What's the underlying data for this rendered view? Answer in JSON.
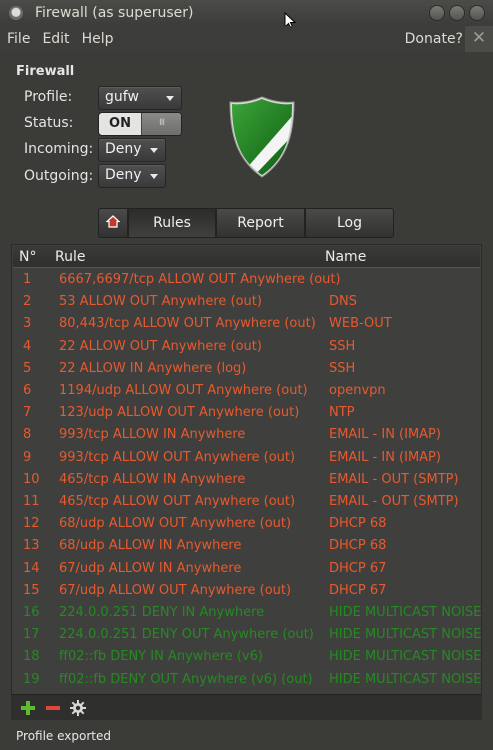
{
  "window": {
    "title": "Firewall (as superuser)",
    "buttons": [
      "•",
      "•",
      "•"
    ]
  },
  "menu": {
    "items": [
      "File",
      "Edit",
      "Help"
    ],
    "donate": "Donate?",
    "close_glyph": "✕"
  },
  "firewall": {
    "section_title": "Firewall",
    "profile_label": "Profile:",
    "profile_value": "gufw",
    "status_label": "Status:",
    "status_value": "ON",
    "status_knob": "III",
    "incoming_label": "Incoming:",
    "incoming_value": "Deny",
    "outgoing_label": "Outgoing:",
    "outgoing_value": "Deny"
  },
  "tabs": {
    "home_icon": "home-icon",
    "items": [
      "Rules",
      "Report",
      "Log"
    ],
    "active": "Rules"
  },
  "rules": {
    "columns": [
      "N°",
      "Rule",
      "Name"
    ],
    "rows": [
      {
        "n": "1",
        "rule": "6667,6697/tcp ALLOW OUT Anywhere (out)",
        "name": "",
        "color": "#e85a2e"
      },
      {
        "n": "2",
        "rule": "53 ALLOW OUT Anywhere (out)",
        "name": "DNS",
        "color": "#e85a2e"
      },
      {
        "n": "3",
        "rule": "80,443/tcp ALLOW OUT Anywhere (out)",
        "name": "WEB-OUT",
        "color": "#e85a2e"
      },
      {
        "n": "4",
        "rule": "22 ALLOW OUT Anywhere (out)",
        "name": "SSH",
        "color": "#e85a2e"
      },
      {
        "n": "5",
        "rule": "22 ALLOW IN Anywhere (log)",
        "name": "SSH",
        "color": "#e85a2e"
      },
      {
        "n": "6",
        "rule": "1194/udp ALLOW OUT Anywhere (out)",
        "name": "openvpn",
        "color": "#e85a2e"
      },
      {
        "n": "7",
        "rule": "123/udp ALLOW OUT Anywhere (out)",
        "name": "NTP",
        "color": "#e85a2e"
      },
      {
        "n": "8",
        "rule": "993/tcp ALLOW IN Anywhere",
        "name": "EMAIL - IN (IMAP)",
        "color": "#e85a2e"
      },
      {
        "n": "9",
        "rule": "993/tcp ALLOW OUT Anywhere (out)",
        "name": "EMAIL - IN (IMAP)",
        "color": "#e85a2e"
      },
      {
        "n": "10",
        "rule": "465/tcp ALLOW IN Anywhere",
        "name": "EMAIL - OUT (SMTP)",
        "color": "#e85a2e"
      },
      {
        "n": "11",
        "rule": "465/tcp ALLOW OUT Anywhere (out)",
        "name": "EMAIL - OUT (SMTP)",
        "color": "#e85a2e"
      },
      {
        "n": "12",
        "rule": "68/udp ALLOW OUT Anywhere (out)",
        "name": "DHCP 68",
        "color": "#e85a2e"
      },
      {
        "n": "13",
        "rule": "68/udp ALLOW IN Anywhere",
        "name": "DHCP 68",
        "color": "#e85a2e"
      },
      {
        "n": "14",
        "rule": "67/udp ALLOW IN Anywhere",
        "name": "DHCP 67",
        "color": "#e85a2e"
      },
      {
        "n": "15",
        "rule": "67/udp ALLOW OUT Anywhere (out)",
        "name": "DHCP 67",
        "color": "#e85a2e"
      },
      {
        "n": "16",
        "rule": "224.0.0.251 DENY IN Anywhere",
        "name": "HIDE MULTICAST NOISE",
        "color": "#268a23"
      },
      {
        "n": "17",
        "rule": "224.0.0.251 DENY OUT Anywhere (out)",
        "name": "HIDE MULTICAST NOISE",
        "color": "#268a23"
      },
      {
        "n": "18",
        "rule": "ff02::fb DENY IN Anywhere (v6)",
        "name": "HIDE MULTICAST NOISE",
        "color": "#268a23"
      },
      {
        "n": "19",
        "rule": "ff02::fb DENY OUT Anywhere (v6) (out)",
        "name": "HIDE MULTICAST NOISE",
        "color": "#268a23"
      }
    ]
  },
  "toolbar": {
    "add_icon": "plus-icon",
    "remove_icon": "minus-icon",
    "settings_icon": "gear-icon"
  },
  "status_bar": {
    "text": "Profile exported"
  }
}
